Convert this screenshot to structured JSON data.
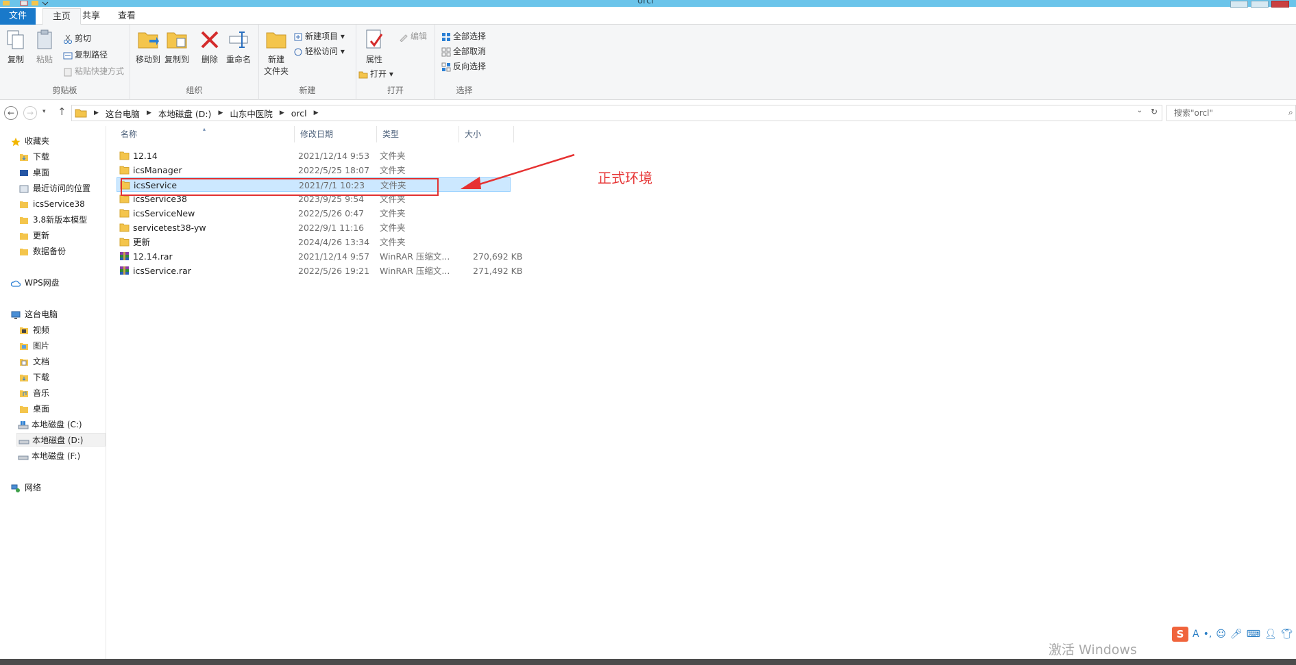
{
  "window": {
    "title": "orcl"
  },
  "tabs": {
    "file": "文件",
    "home": "主页",
    "share": "共享",
    "view": "查看"
  },
  "ribbon": {
    "clipboard": {
      "copy": "复制",
      "paste": "粘贴",
      "cut": "剪切",
      "copy_path": "复制路径",
      "paste_shortcut": "粘贴快捷方式",
      "label": "剪贴板"
    },
    "organize": {
      "move_to": "移动到",
      "copy_to": "复制到",
      "delete": "删除",
      "rename": "重命名",
      "label": "组织"
    },
    "new": {
      "new_folder_line1": "新建",
      "new_folder_line2": "文件夹",
      "new_item": "新建项目",
      "easy_access": "轻松访问",
      "label": "新建"
    },
    "open": {
      "properties": "属性",
      "open": "打开",
      "edit": "编辑",
      "label": "打开"
    },
    "select": {
      "select_all": "全部选择",
      "select_none": "全部取消",
      "invert": "反向选择",
      "label": "选择"
    }
  },
  "address": {
    "crumbs": [
      "这台电脑",
      "本地磁盘 (D:)",
      "山东中医院",
      "orcl"
    ],
    "search_placeholder": "搜索\"orcl\""
  },
  "nav": {
    "favorites": "收藏夹",
    "fav_items": [
      "下载",
      "桌面",
      "最近访问的位置",
      "icsService38",
      "3.8新版本模型",
      "更新",
      "数据备份"
    ],
    "wps": "WPS网盘",
    "this_pc": "这台电脑",
    "pc_items": [
      "视频",
      "图片",
      "文档",
      "下载",
      "音乐",
      "桌面",
      "本地磁盘 (C:)",
      "本地磁盘 (D:)",
      "本地磁盘 (F:)"
    ],
    "network": "网络"
  },
  "columns": {
    "name": "名称",
    "date": "修改日期",
    "type": "类型",
    "size": "大小"
  },
  "files": [
    {
      "name": "12.14",
      "date": "2021/12/14 9:53",
      "type": "文件夹",
      "size": ""
    },
    {
      "name": "icsManager",
      "date": "2022/5/25 18:07",
      "type": "文件夹",
      "size": ""
    },
    {
      "name": "icsService",
      "date": "2021/7/1 10:23",
      "type": "文件夹",
      "size": ""
    },
    {
      "name": "icsService38",
      "date": "2023/9/25 9:54",
      "type": "文件夹",
      "size": ""
    },
    {
      "name": "icsServiceNew",
      "date": "2022/5/26 0:47",
      "type": "文件夹",
      "size": ""
    },
    {
      "name": "servicetest38-yw",
      "date": "2022/9/1 11:16",
      "type": "文件夹",
      "size": ""
    },
    {
      "name": "更新",
      "date": "2024/4/26 13:34",
      "type": "文件夹",
      "size": ""
    },
    {
      "name": "12.14.rar",
      "date": "2021/12/14 9:57",
      "type": "WinRAR 压缩文...",
      "size": "270,692 KB"
    },
    {
      "name": "icsService.rar",
      "date": "2022/5/26 19:21",
      "type": "WinRAR 压缩文...",
      "size": "271,492 KB"
    }
  ],
  "annotation": {
    "label": "正式环境"
  },
  "watermark": "激活 Windows",
  "ime": {
    "logo": "S",
    "mode": "A"
  },
  "colors": {
    "accent": "#1979ca",
    "selection": "#cce8ff",
    "annotation": "#e23030",
    "folder": "#f4c54c"
  }
}
